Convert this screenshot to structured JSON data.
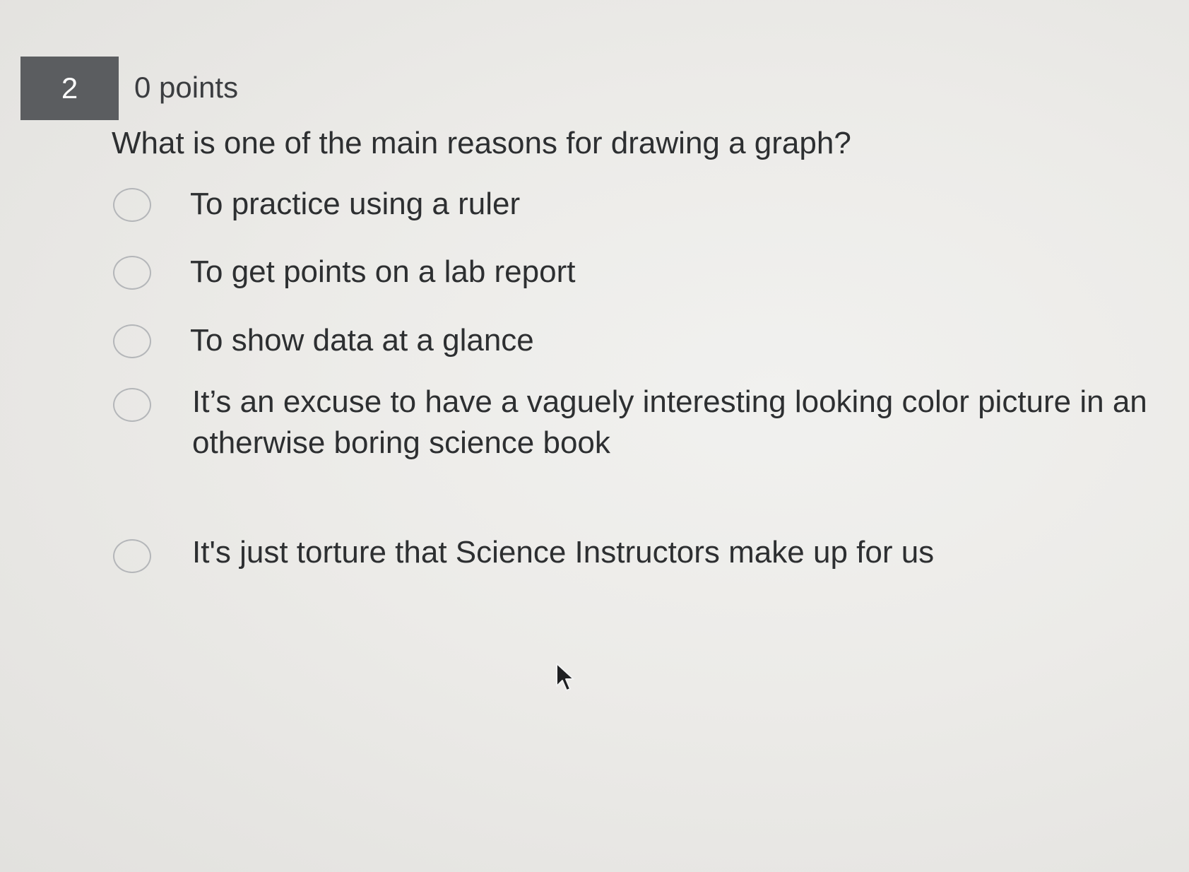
{
  "question": {
    "number": "2",
    "points": "0 points",
    "text": "What is one of the main reasons for drawing a graph?",
    "options": [
      {
        "label": "To practice using a ruler"
      },
      {
        "label": "To get points on a lab report"
      },
      {
        "label": "To show data at a glance"
      },
      {
        "label": "It’s an excuse to have a vaguely interesting looking color picture in an otherwise boring science book"
      },
      {
        "label": "It's just torture that Science Instructors make up for us"
      }
    ]
  },
  "colors": {
    "number_badge_bg": "#5b5d60",
    "text": "#2d2f31",
    "radio_border": "#b4b6b9"
  },
  "icons": {
    "option_selector": "radio-unselected",
    "pointer": "mouse-cursor-arrow"
  }
}
